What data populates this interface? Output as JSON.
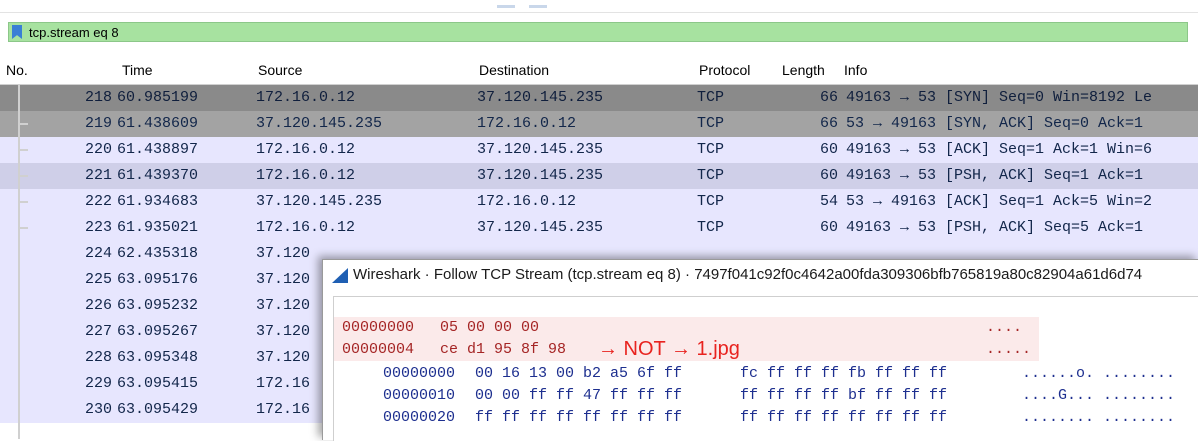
{
  "filter": {
    "icon": "bookmark-icon",
    "value": "tcp.stream eq 8"
  },
  "columns": [
    "No.",
    "Time",
    "Source",
    "Destination",
    "Protocol",
    "Length",
    "Info"
  ],
  "packets": [
    {
      "no": "218",
      "time": "60.985199",
      "src": "172.16.0.12",
      "dst": "37.120.145.235",
      "proto": "TCP",
      "len": "66",
      "info": "49163 → 53 [SYN] Seq=0 Win=8192 Le",
      "bg": "#8a8a8a"
    },
    {
      "no": "219",
      "time": "61.438609",
      "src": "37.120.145.235",
      "dst": "172.16.0.12",
      "proto": "TCP",
      "len": "66",
      "info": "53 → 49163 [SYN, ACK] Seq=0 Ack=1",
      "bg": "#a3a3a3"
    },
    {
      "no": "220",
      "time": "61.438897",
      "src": "172.16.0.12",
      "dst": "37.120.145.235",
      "proto": "TCP",
      "len": "60",
      "info": "49163 → 53 [ACK] Seq=1 Ack=1 Win=6",
      "bg": "#e7e6fe"
    },
    {
      "no": "221",
      "time": "61.439370",
      "src": "172.16.0.12",
      "dst": "37.120.145.235",
      "proto": "TCP",
      "len": "60",
      "info": "49163 → 53 [PSH, ACK] Seq=1 Ack=1",
      "bg": "#cfcfe8"
    },
    {
      "no": "222",
      "time": "61.934683",
      "src": "37.120.145.235",
      "dst": "172.16.0.12",
      "proto": "TCP",
      "len": "54",
      "info": "53 → 49163 [ACK] Seq=1 Ack=5 Win=2",
      "bg": "#e7e6fe"
    },
    {
      "no": "223",
      "time": "61.935021",
      "src": "172.16.0.12",
      "dst": "37.120.145.235",
      "proto": "TCP",
      "len": "60",
      "info": "49163 → 53 [PSH, ACK] Seq=5 Ack=1",
      "bg": "#e7e6fe"
    },
    {
      "no": "224",
      "time": "62.435318",
      "src": "37.120",
      "dst": "",
      "proto": "",
      "len": "",
      "info": "",
      "bg": "#e7e6fe"
    },
    {
      "no": "225",
      "time": "63.095176",
      "src": "37.120",
      "dst": "",
      "proto": "",
      "len": "",
      "info": "",
      "bg": "#e7e6fe"
    },
    {
      "no": "226",
      "time": "63.095232",
      "src": "37.120",
      "dst": "",
      "proto": "",
      "len": "",
      "info": "",
      "bg": "#e7e6fe"
    },
    {
      "no": "227",
      "time": "63.095267",
      "src": "37.120",
      "dst": "",
      "proto": "",
      "len": "",
      "info": "",
      "bg": "#e7e6fe"
    },
    {
      "no": "228",
      "time": "63.095348",
      "src": "37.120",
      "dst": "",
      "proto": "",
      "len": "",
      "info": "",
      "bg": "#e7e6fe"
    },
    {
      "no": "229",
      "time": "63.095415",
      "src": "172.16",
      "dst": "",
      "proto": "",
      "len": "",
      "info": "",
      "bg": "#e7e6fe"
    },
    {
      "no": "230",
      "time": "63.095429",
      "src": "172.16",
      "dst": "",
      "proto": "",
      "len": "",
      "info": "",
      "bg": "#e7e6fe"
    }
  ],
  "dialog": {
    "icon": "wireshark-fin-icon",
    "title": "Wireshark · Follow TCP Stream (tcp.stream eq 8) · 7497f041c92f0c4642a00fda309306bfb765819a80c82904a61d6d74",
    "client_lines": [
      {
        "offset": "00000000",
        "hex": "05 00 00 00",
        "annotation": "",
        "ascii": "...."
      },
      {
        "offset": "00000004",
        "hex": "ce d1 95 8f 98",
        "annotation": "→ NOT → 1.jpg",
        "ascii": "....."
      }
    ],
    "server_lines": [
      {
        "offset": "00000000",
        "hex1": "00 16 13 00 b2 a5 6f ff",
        "hex2": "fc ff ff ff fb ff ff ff",
        "ascii": "......o. ........"
      },
      {
        "offset": "00000010",
        "hex1": "00 00 ff ff 47 ff ff ff",
        "hex2": "ff ff ff ff bf ff ff ff",
        "ascii": "....G... ........"
      },
      {
        "offset": "00000020",
        "hex1": "ff ff ff ff ff ff ff ff",
        "hex2": "ff ff ff ff ff ff ff ff",
        "ascii": "........ ........"
      }
    ],
    "colors": {
      "client_text": "#a52525",
      "client_bg": "#fbeaea",
      "server_text": "#1d2f8f",
      "annotation": "#e8231f"
    }
  }
}
